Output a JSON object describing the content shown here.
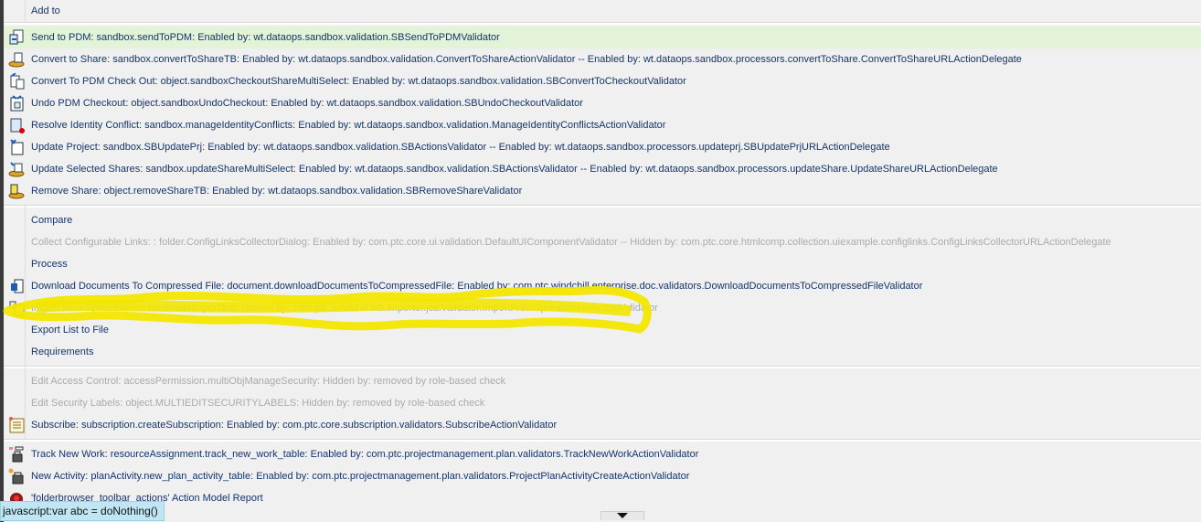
{
  "sections": [
    {
      "rows": [
        {
          "label": "Add to",
          "icon": "none",
          "disabled": false
        }
      ]
    },
    {
      "rows": [
        {
          "label": "Send to PDM: sandbox.sendToPDM: Enabled by: wt.dataops.sandbox.validation.SBSendToPDMValidator",
          "icon": "send-to-pdm-icon",
          "disabled": false,
          "highlighted": true
        },
        {
          "label": "Convert to Share: sandbox.convertToShareTB: Enabled by: wt.dataops.sandbox.validation.ConvertToShareActionValidator -- Enabled by: wt.dataops.sandbox.processors.convertToShare.ConvertToShareURLActionDelegate",
          "icon": "convert-to-share-icon",
          "disabled": false
        },
        {
          "label": "Convert To PDM Check Out: object.sandboxCheckoutShareMultiSelect: Enabled by: wt.dataops.sandbox.validation.SBConvertToCheckoutValidator",
          "icon": "convert-checkout-icon",
          "disabled": false
        },
        {
          "label": "Undo PDM Checkout: object.sandboxUndoCheckout: Enabled by: wt.dataops.sandbox.validation.SBUndoCheckoutValidator",
          "icon": "undo-checkout-icon",
          "disabled": false
        },
        {
          "label": "Resolve Identity Conflict: sandbox.manageIdentityConflicts: Enabled by: wt.dataops.sandbox.validation.ManageIdentityConflictsActionValidator",
          "icon": "resolve-conflict-icon",
          "disabled": false
        },
        {
          "label": "Update Project: sandbox.SBUpdatePrj: Enabled by: wt.dataops.sandbox.validation.SBActionsValidator -- Enabled by: wt.dataops.sandbox.processors.updateprj.SBUpdatePrjURLActionDelegate",
          "icon": "update-project-icon",
          "disabled": false
        },
        {
          "label": "Update Selected Shares: sandbox.updateShareMultiSelect: Enabled by: wt.dataops.sandbox.validation.SBActionsValidator -- Enabled by: wt.dataops.sandbox.processors.updateShare.UpdateShareURLActionDelegate",
          "icon": "update-shares-icon",
          "disabled": false
        },
        {
          "label": "Remove Share: object.removeShareTB: Enabled by: wt.dataops.sandbox.validation.SBRemoveShareValidator",
          "icon": "remove-share-icon",
          "disabled": false
        }
      ]
    },
    {
      "rows": [
        {
          "label": "Compare",
          "icon": "none",
          "disabled": false
        },
        {
          "label": "Collect Configurable Links: : folder.ConfigLinksCollectorDialog: Enabled by: com.ptc.core.ui.validation.DefaultUIComponentValidator -- Hidden by: com.ptc.core.htmlcomp.collection.uiexample.configlinks.ConfigLinksCollectorURLActionDelegate",
          "icon": "none",
          "disabled": true
        },
        {
          "label": "Process",
          "icon": "none",
          "disabled": false
        },
        {
          "label": "Download Documents To Compressed File: document.downloadDocumentsToCompressedFile: Enabled by: com.ptc.windchill.enterprise.doc.validators.DownloadDocumentsToCompressedFileValidator",
          "icon": "download-documents-icon",
          "disabled": false
        },
        {
          "label": "Import from Spreadsheet: ixb.createImportJob: Hidden by: com.ptc.windchill.ixb.importer.jca.validator.ImportFromSpreadsheetActionValidator",
          "icon": "import-spreadsheet-icon",
          "disabled": true
        },
        {
          "label": "Export List to File",
          "icon": "none",
          "disabled": false
        },
        {
          "label": "Requirements",
          "icon": "none",
          "disabled": false
        }
      ]
    },
    {
      "rows": [
        {
          "label": "Edit Access Control: accessPermission.multiObjManageSecurity: Hidden by: removed by role-based check",
          "icon": "none",
          "disabled": true
        },
        {
          "label": "Edit Security Labels: object.MULTIEDITSECURITYLABELS: Hidden by: removed by role-based check",
          "icon": "none",
          "disabled": true
        },
        {
          "label": "Subscribe: subscription.createSubscription: Enabled by: com.ptc.core.subscription.validators.SubscribeActionValidator",
          "icon": "subscribe-icon",
          "disabled": false
        }
      ]
    },
    {
      "rows": [
        {
          "label": "Track New Work: resourceAssignment.track_new_work_table: Enabled by: com.ptc.projectmanagement.plan.validators.TrackNewWorkActionValidator",
          "icon": "track-new-work-icon",
          "disabled": false
        },
        {
          "label": "New Activity: planActivity.new_plan_activity_table: Enabled by: com.ptc.projectmanagement.plan.validators.ProjectPlanActivityCreateActionValidator",
          "icon": "new-activity-icon",
          "disabled": false
        },
        {
          "label": "'folderbrowser_toolbar_actions' Action Model Report",
          "icon": "action-model-report-icon",
          "disabled": false
        }
      ]
    }
  ],
  "status_bar": {
    "text": "javascript:var abc = doNothing()"
  },
  "colors": {
    "highlight": "#e3f3d8",
    "link": "#14356b",
    "disabled": "#ababab",
    "annotation": "#f2e600"
  }
}
